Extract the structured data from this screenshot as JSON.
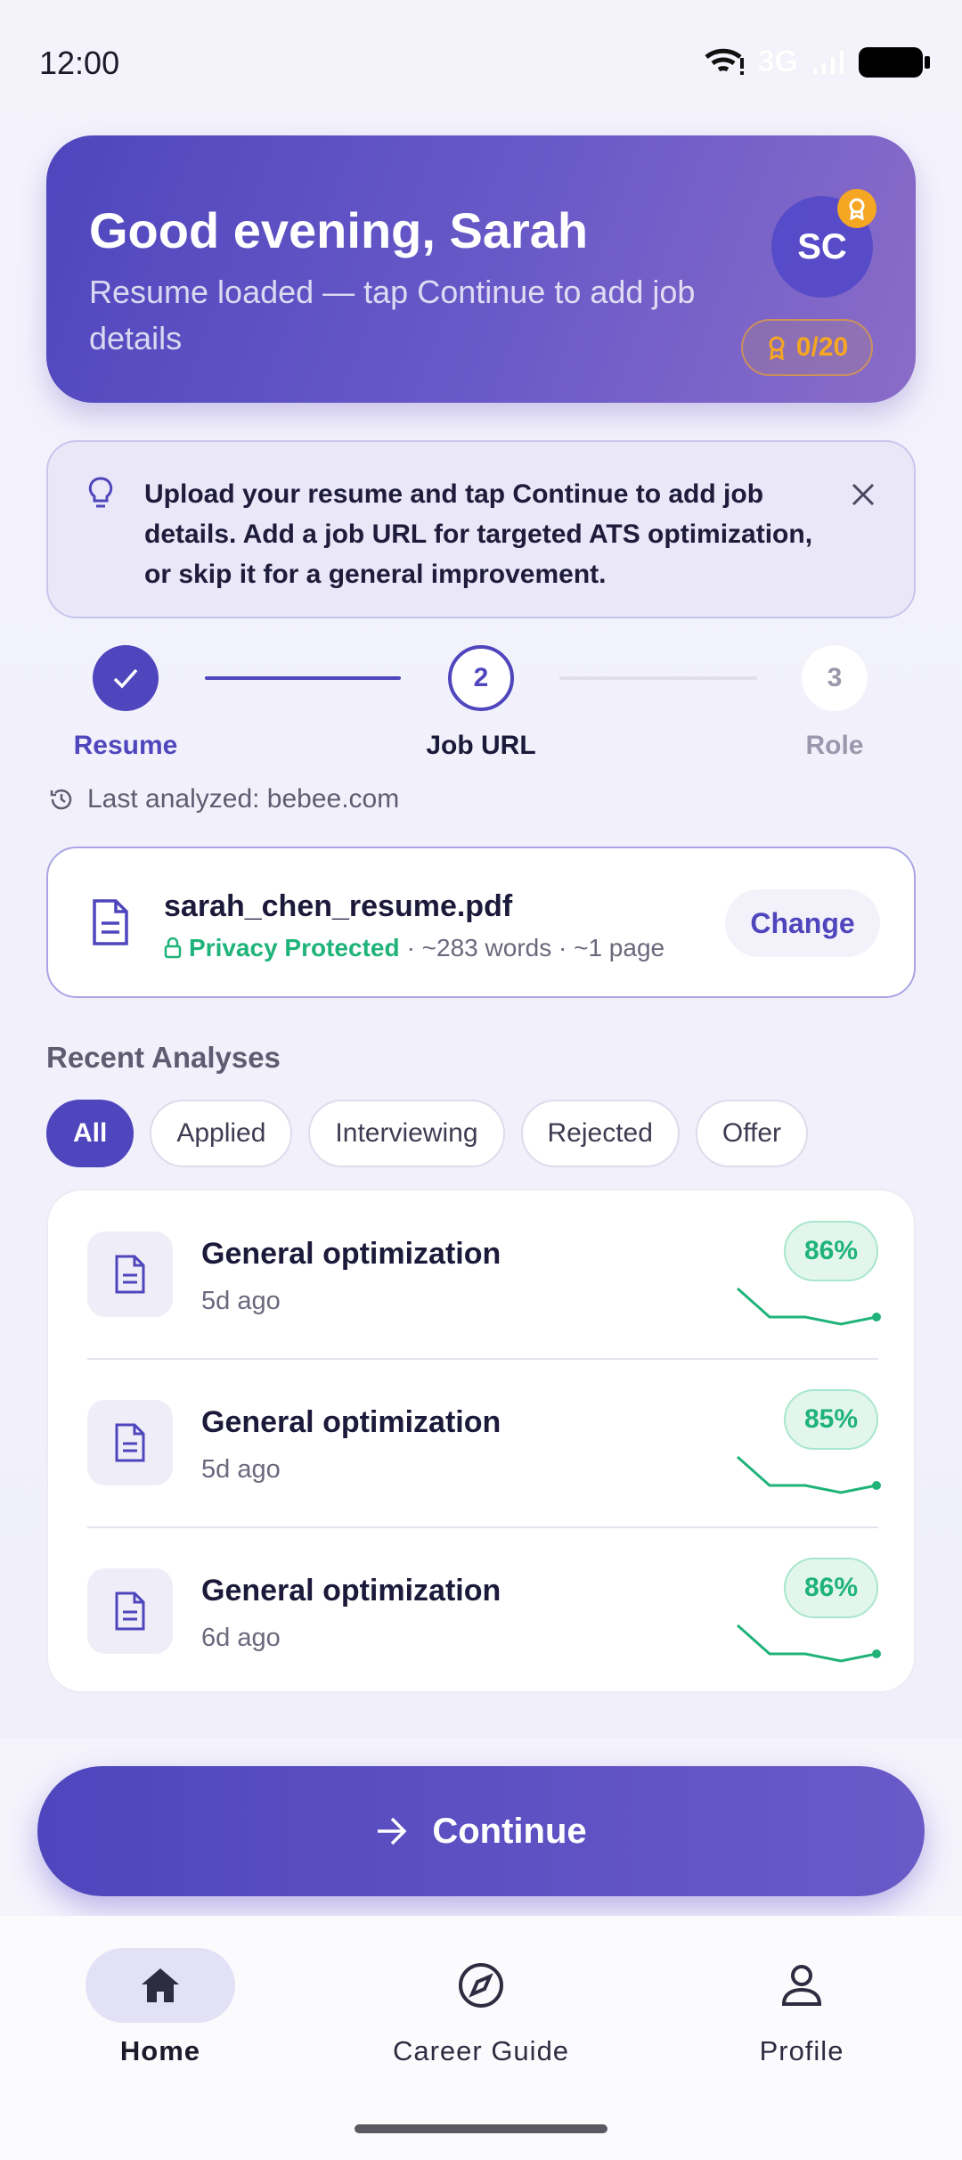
{
  "status_bar": {
    "time": "12:00",
    "network": "3G"
  },
  "header": {
    "greeting": "Good evening, Sarah",
    "subtitle": "Resume loaded — tap Continue to add job details",
    "avatar_initials": "SC",
    "points": "0/20",
    "gradient_start": "#4f46bd",
    "gradient_end": "#8a6cc8"
  },
  "tip": {
    "text": "Upload your resume and tap Continue to add job details. Add a job URL for targeted ATS optimization, or skip it for a general improvement."
  },
  "stepper": {
    "steps": [
      {
        "number": "1",
        "label": "Resume",
        "state": "completed"
      },
      {
        "number": "2",
        "label": "Job URL",
        "state": "current"
      },
      {
        "number": "3",
        "label": "Role",
        "state": "upcoming"
      }
    ]
  },
  "last_analyzed": "Last analyzed: bebee.com",
  "resume_file": {
    "name": "sarah_chen_resume.pdf",
    "privacy": "Privacy Protected",
    "meta": "· ~283 words · ~1 page",
    "change_label": "Change"
  },
  "recent": {
    "title": "Recent Analyses",
    "filters": [
      "All",
      "Applied",
      "Interviewing",
      "Rejected",
      "Offer"
    ],
    "active_filter": "All",
    "items": [
      {
        "title": "General optimization",
        "age": "5d ago",
        "score": "86%"
      },
      {
        "title": "General optimization",
        "age": "5d ago",
        "score": "85%"
      },
      {
        "title": "General optimization",
        "age": "6d ago",
        "score": "86%"
      }
    ]
  },
  "continue_label": "Continue",
  "nav": {
    "items": [
      {
        "label": "Home",
        "icon": "home-icon",
        "active": true
      },
      {
        "label": "Career Guide",
        "icon": "compass-icon",
        "active": false
      },
      {
        "label": "Profile",
        "icon": "person-icon",
        "active": false
      }
    ]
  },
  "colors": {
    "accent": "#4f46bd",
    "success": "#1fb37a",
    "award": "#f5a623"
  }
}
